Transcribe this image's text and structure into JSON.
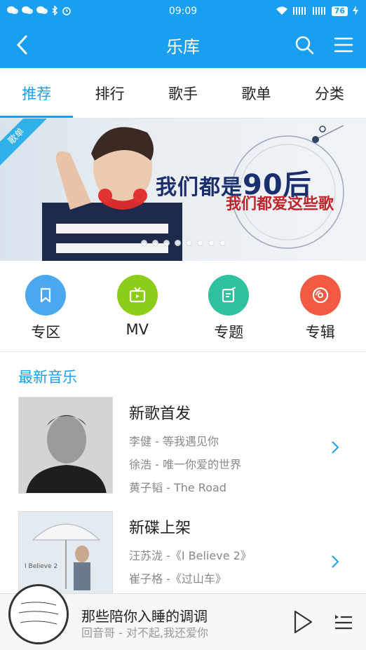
{
  "status": {
    "time": "09:09",
    "battery": "76"
  },
  "header": {
    "title": "乐库"
  },
  "tabs": [
    {
      "label": "推荐",
      "active": true
    },
    {
      "label": "排行",
      "active": false
    },
    {
      "label": "歌手",
      "active": false
    },
    {
      "label": "歌单",
      "active": false
    },
    {
      "label": "分类",
      "active": false
    }
  ],
  "banner": {
    "ribbon": "歌单",
    "title_prefix": "我们都是",
    "title_number": "90后",
    "subtitle": "我们都爱这些歌",
    "slide_count": 8,
    "active_slide": 1
  },
  "quick_entries": [
    {
      "label": "专区",
      "icon": "bookmark-icon",
      "color": "#4aa8f0"
    },
    {
      "label": "MV",
      "icon": "tv-icon",
      "color": "#8ccc1a"
    },
    {
      "label": "专题",
      "icon": "edit-note-icon",
      "color": "#2fc0a0"
    },
    {
      "label": "专辑",
      "icon": "disc-icon",
      "color": "#f25a42"
    }
  ],
  "latest": {
    "title": "最新音乐",
    "cards": [
      {
        "title": "新歌首发",
        "lines": [
          "李健 - 等我遇见你",
          "徐浩 - 唯一你爱的世界",
          "黄子韬 - The Road"
        ]
      },
      {
        "title": "新碟上架",
        "lines": [
          "汪苏泷 -《I Believe 2》",
          "崔子格 -《过山车》"
        ]
      }
    ]
  },
  "player": {
    "title": "那些陪你入睡的调调",
    "subtitle": "回音哥 - 对不起,我还爱你"
  },
  "colors": {
    "accent": "#1a9ff0"
  }
}
